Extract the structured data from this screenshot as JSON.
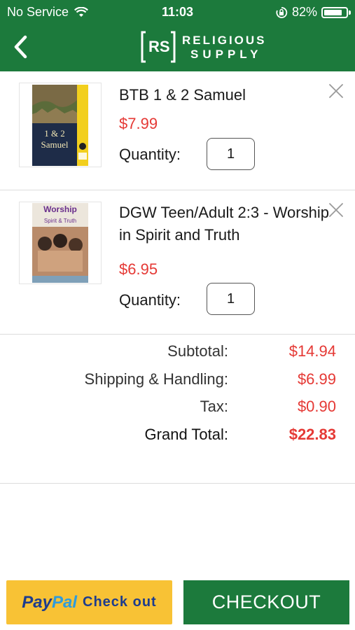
{
  "status_bar": {
    "carrier": "No Service",
    "time": "11:03",
    "battery_percent": "82%",
    "battery_level": 0.82
  },
  "header": {
    "back_icon": "chevron-left-icon",
    "logo_mark": "RS",
    "logo_line1": "RELIGIOUS",
    "logo_line2": "SUPPLY",
    "background_color": "#1c7a3c"
  },
  "cart": {
    "items": [
      {
        "name": "BTB 1 & 2 Samuel",
        "price": "$7.99",
        "quantity_label": "Quantity:",
        "quantity": "1",
        "cover_title_line1": "1 & 2",
        "cover_title_line2": "Samuel",
        "remove_icon": "close-icon"
      },
      {
        "name": "DGW Teen/Adult 2:3 - Worship in Spirit and Truth",
        "price": "$6.95",
        "quantity_label": "Quantity:",
        "quantity": "1",
        "cover_title_line1": "Worship",
        "cover_title_line2": "Spirit & Truth",
        "remove_icon": "close-icon"
      }
    ]
  },
  "totals": {
    "subtotal_label": "Subtotal:",
    "subtotal": "$14.94",
    "shipping_label": "Shipping & Handling:",
    "shipping": "$6.99",
    "tax_label": "Tax:",
    "tax": "$0.90",
    "grand_total_label": "Grand Total:",
    "grand_total": "$22.83",
    "value_color": "#e53935"
  },
  "buttons": {
    "paypal_pay": "Pay",
    "paypal_pal": "Pal",
    "paypal_action": "Check out",
    "checkout": "CHECKOUT"
  }
}
